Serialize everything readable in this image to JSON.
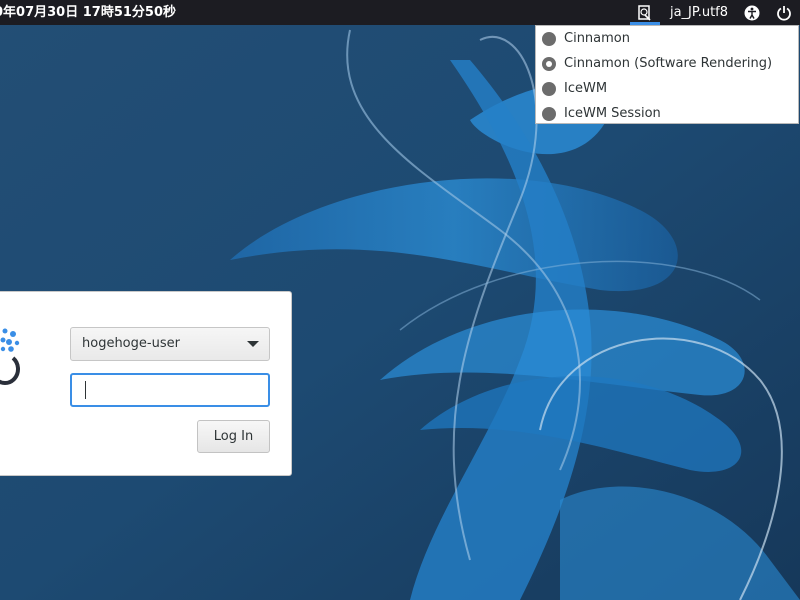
{
  "panel": {
    "clock": "0年07月30日 17時51分50秒",
    "language": "ja_JP.utf8",
    "session_icon": "session-select-icon",
    "accessibility_icon": "accessibility-icon",
    "power_icon": "power-icon"
  },
  "session_menu": {
    "items": [
      {
        "label": "Cinnamon",
        "selected": false
      },
      {
        "label": "Cinnamon (Software Rendering)",
        "selected": true
      },
      {
        "label": "IceWM",
        "selected": false
      },
      {
        "label": "IceWM Session",
        "selected": false
      }
    ]
  },
  "login": {
    "username": "hogehoge-user",
    "password_value": "",
    "login_label": "Log In"
  },
  "colors": {
    "accent": "#3a8ee6",
    "panel_bg": "#1c1c22",
    "wallpaper_base": "#1f4f7a"
  }
}
